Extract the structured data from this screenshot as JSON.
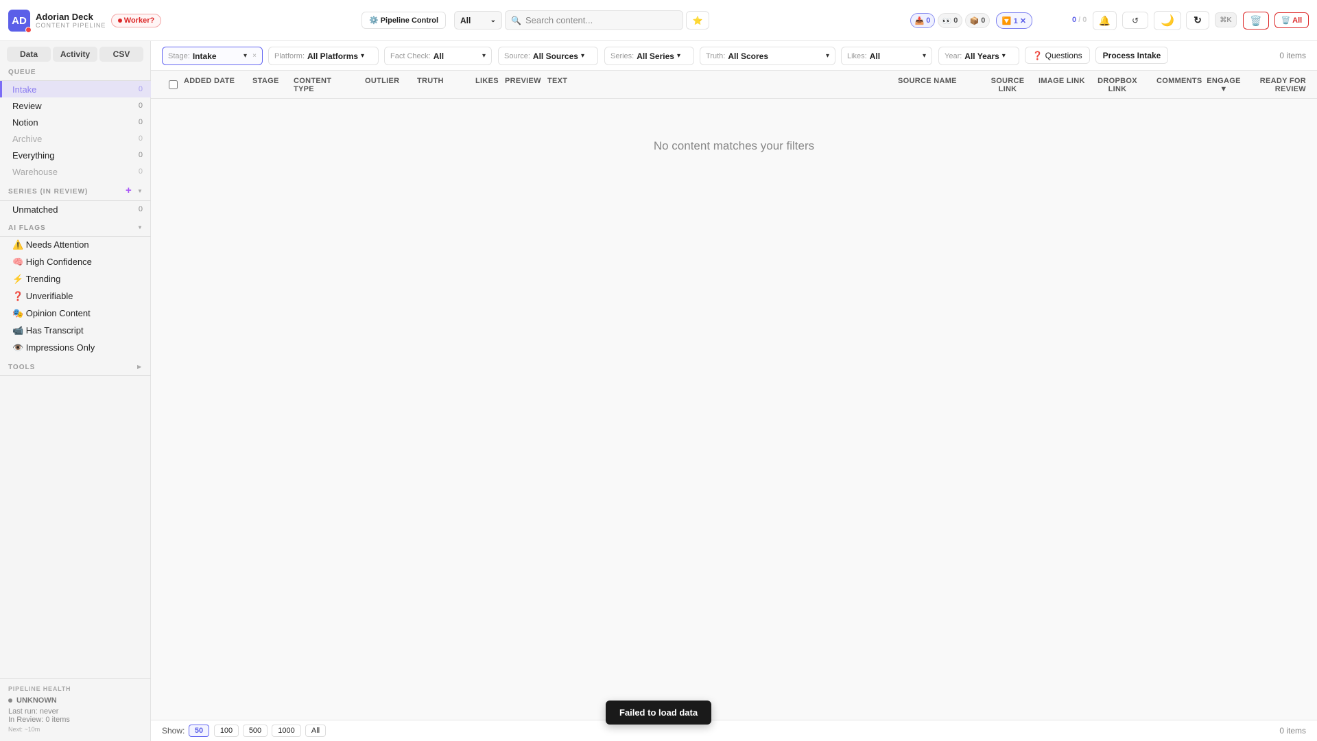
{
  "app": {
    "initials": "AD",
    "title": "Adorian Deck",
    "subtitle": "CONTENT PIPELINE",
    "worker_badge": "Worker?"
  },
  "toolbar": {
    "pipeline_control": "⚙️ Pipeline Control",
    "scope_select": "All",
    "search_placeholder": "Search content...",
    "star": "⭐",
    "counters": [
      {
        "icon": "📥",
        "value": "0"
      },
      {
        "icon": "👀",
        "value": "0"
      },
      {
        "icon": "📦",
        "value": "0"
      }
    ],
    "filter_count": "🔽 1 ✕",
    "progress_done": "0",
    "progress_total": "0",
    "bell": "🔔",
    "undo": "↺",
    "moon": "🌙",
    "refresh": "↻",
    "shortcut": "⌘K",
    "trash": "🗑️",
    "trash_all": "🗑️ All"
  },
  "sidebar": {
    "tabs": [
      "Data",
      "Activity",
      "CSV"
    ],
    "queue_title": "QUEUE",
    "queue": [
      {
        "label": "Intake",
        "count": "0"
      },
      {
        "label": "Review",
        "count": "0"
      },
      {
        "label": "Notion",
        "count": "0"
      },
      {
        "label": "Archive",
        "count": "0"
      },
      {
        "label": "Everything",
        "count": "0"
      },
      {
        "label": "Warehouse",
        "count": "0"
      }
    ],
    "series_title": "SERIES (IN REVIEW)",
    "series_add": "+",
    "series": [
      {
        "label": "Unmatched",
        "count": "0"
      }
    ],
    "flags_title": "AI FLAGS",
    "flags": [
      "⚠️ Needs Attention",
      "🧠 High Confidence",
      "⚡ Trending",
      "❓ Unverifiable",
      "🎭 Opinion Content",
      "📹 Has Transcript",
      "👁️ Impressions Only"
    ],
    "tools_title": "TOOLS",
    "health": {
      "title": "PIPELINE HEALTH",
      "status": "UNKNOWN",
      "last_run": "Last run: never",
      "in_review": "In Review: 0 items",
      "next": "Next: ~10m"
    }
  },
  "filters": [
    {
      "label": "Stage:",
      "value": "Intake"
    },
    {
      "label": "Platform:",
      "value": "All Platforms"
    },
    {
      "label": "Fact Check:",
      "value": "All"
    },
    {
      "label": "Source:",
      "value": "All Sources"
    },
    {
      "label": "Series:",
      "value": "All Series"
    },
    {
      "label": "Truth:",
      "value": "All Scores"
    },
    {
      "label": "Likes:",
      "value": "All"
    },
    {
      "label": "Year:",
      "value": "All Years"
    }
  ],
  "actions": {
    "questions": "❓ Questions",
    "process_intake": "Process Intake",
    "item_count": "0 items"
  },
  "table": {
    "columns": [
      "ADDED DATE",
      "STAGE",
      "CONTENT TYPE",
      "OUTLIER",
      "TRUTH",
      "LIKES",
      "PREVIEW",
      "TEXT",
      "SOURCE NAME",
      "SOURCE LINK",
      "IMAGE LINK",
      "DROPBOX LINK",
      "COMMENTS",
      "ENGAGE ▼",
      "READY FOR REVIEW"
    ],
    "empty": "No content matches your filters"
  },
  "footer": {
    "show_label": "Show:",
    "page_sizes": [
      "50",
      "100",
      "500",
      "1000",
      "All"
    ],
    "item_count": "0 items"
  },
  "toast": "Failed to load data"
}
